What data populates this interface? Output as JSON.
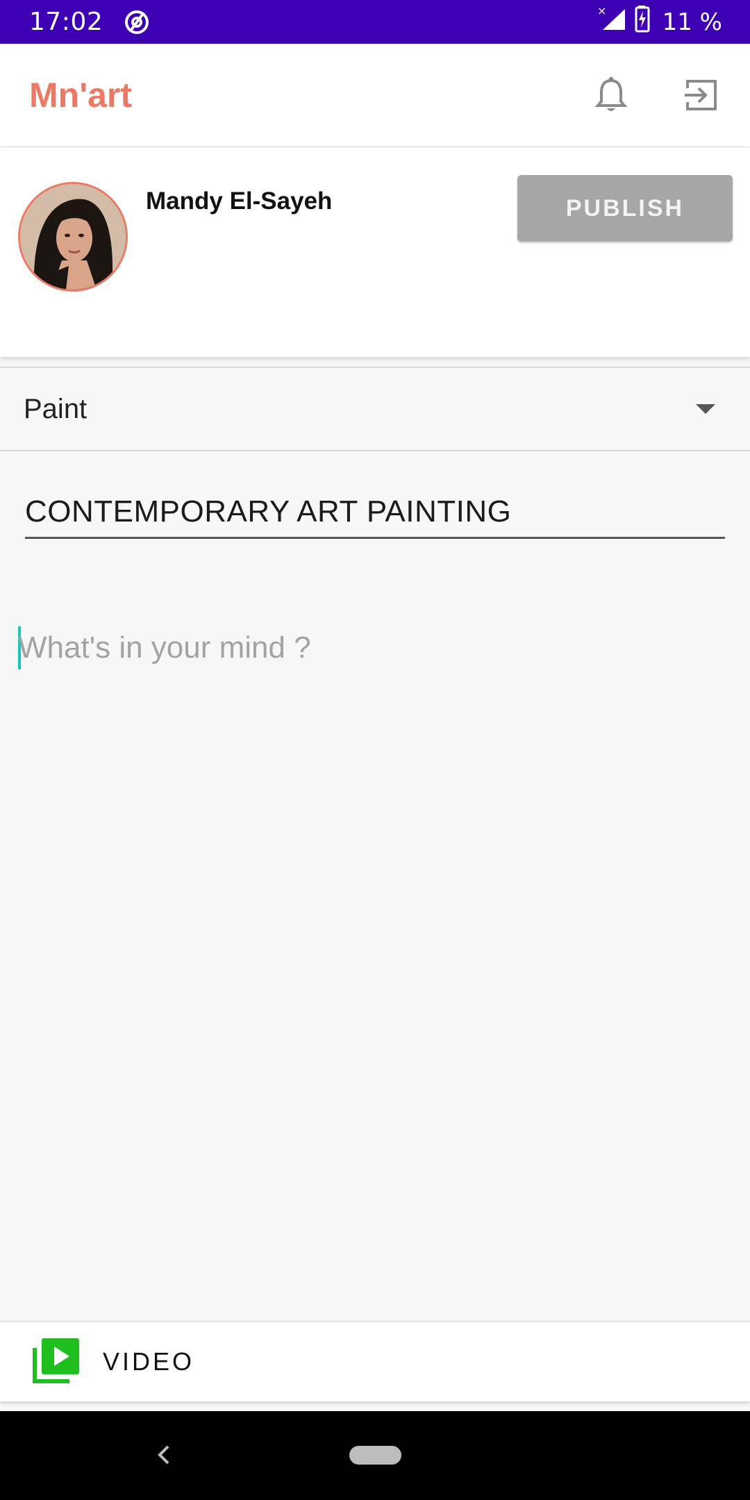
{
  "status_bar": {
    "time": "17:02",
    "battery_text": "11 %",
    "icons": [
      "sync-icon",
      "signal-icon",
      "battery-charging-icon"
    ]
  },
  "app_bar": {
    "title": "Mn'art",
    "title_color": "#ea7a66",
    "icons": [
      "bell-icon",
      "logout-icon"
    ]
  },
  "author": {
    "name": "Mandy El-Sayeh",
    "publish_label": "PUBLISH"
  },
  "form": {
    "category": "Paint",
    "title_value": "CONTEMPORARY ART PAINTING",
    "body_placeholder": "What's in your mind ?"
  },
  "video_bar": {
    "label": "VIDEO",
    "icon": "video-library-icon",
    "icon_color": "#1fbf1f"
  },
  "colors": {
    "status_bar": "#3d00b3",
    "accent": "#ea7a66",
    "publish_disabled": "#a6a6a6",
    "cursor": "#19c7b3"
  }
}
